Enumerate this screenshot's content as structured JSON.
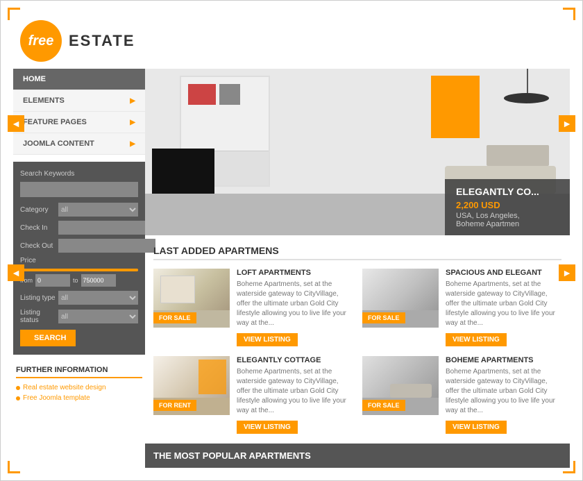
{
  "site": {
    "logo_text": "free",
    "name": "ESTATE"
  },
  "nav": {
    "items": [
      {
        "label": "HOME",
        "active": true,
        "has_arrow": false
      },
      {
        "label": "ELEMENTS",
        "active": false,
        "has_arrow": true
      },
      {
        "label": "FEATURE PAGES",
        "active": false,
        "has_arrow": true
      },
      {
        "label": "JOOMLA CONTENT",
        "active": false,
        "has_arrow": true
      }
    ]
  },
  "search": {
    "keywords_label": "Search Keywords",
    "category_label": "Category",
    "category_value": "all",
    "checkin_label": "Check In",
    "checkout_label": "Check Out",
    "price_label": "Price",
    "from_label": "from",
    "from_value": "0",
    "to_label": "to",
    "to_value": "750000",
    "listing_type_label": "Listing type",
    "listing_type_value": "all",
    "listing_status_label": "Listing status",
    "listing_status_value": "all",
    "button_label": "SEARCH"
  },
  "further": {
    "title": "FURTHER INFORMATION",
    "links": [
      {
        "label": "Real estate website design"
      },
      {
        "label": "Free Joomla template"
      }
    ]
  },
  "hero": {
    "title": "ELEGANTLY CO...",
    "price": "2,200 USD",
    "location": "USA, Los Angeles,",
    "sub_location": "Boheme Apartmen"
  },
  "last_added": {
    "section_title": "LAST ADDED APARTMENS",
    "apartments": [
      {
        "title": "LOFT APARTMENTS",
        "desc": "Boheme Apartments, set at the waterside gateway to CityVillage, offer the ultimate urban Gold City lifestyle allowing you to live life your way at the...",
        "badge": "FOR SALE",
        "badge_type": "sale",
        "btn_label": "VIEW LISTING",
        "img_class": "room-img-1"
      },
      {
        "title": "SPACIOUS AND ELEGANT",
        "desc": "Boheme Apartments, set at the waterside gateway to CityVillage, offer the ultimate urban Gold City lifestyle allowing you to live life your way at the...",
        "badge": "FOR SALE",
        "badge_type": "sale",
        "btn_label": "VIEW LISTING",
        "img_class": "room-img-2"
      },
      {
        "title": "ELEGANTLY COTTAGE",
        "desc": "Boheme Apartments, set at the waterside gateway to CityVillage, offer the ultimate urban Gold City lifestyle allowing you to live life your way at the...",
        "badge": "FOR RENT",
        "badge_type": "rent",
        "btn_label": "VIEW LISTING",
        "img_class": "room-img-3"
      },
      {
        "title": "BOHEME APARTMENTS",
        "desc": "Boheme Apartments, set at the waterside gateway to CityVillage, offer the ultimate urban Gold City lifestyle allowing you to live life your way at the...",
        "badge": "FOR SALE",
        "badge_type": "sale",
        "btn_label": "VIEW LISTING",
        "img_class": "room-img-4"
      }
    ]
  },
  "popular": {
    "title": "THE MOST POPULAR APARTMENTS"
  },
  "arrows": {
    "left": "◄",
    "right": "►"
  }
}
